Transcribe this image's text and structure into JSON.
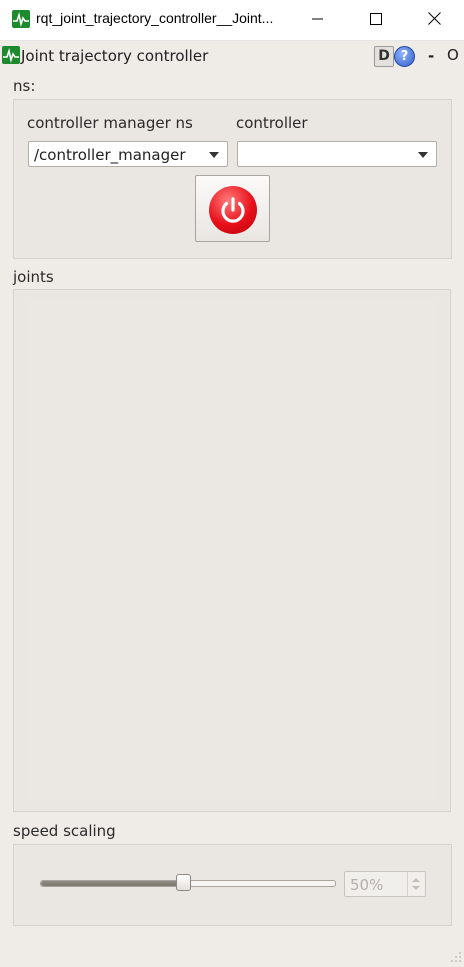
{
  "window": {
    "title": "rqt_joint_trajectory_controller__Joint...",
    "minimize_icon": "minimize-icon",
    "maximize_icon": "maximize-icon",
    "close_icon": "close-icon"
  },
  "plugin": {
    "title": "Joint trajectory controller",
    "d_label": "D",
    "help_label": "?",
    "minimize_label": "-",
    "close_label": "O"
  },
  "ns": {
    "label": "ns:",
    "cm_label": "controller manager ns",
    "cm_value": "/controller_manager",
    "controller_label": "controller",
    "controller_value": "",
    "power_icon": "power-icon",
    "accent_color": "#e8101a"
  },
  "joints": {
    "label": "joints"
  },
  "speed": {
    "label": "speed scaling",
    "value_text": "50%",
    "slider_fraction": 0.5
  }
}
